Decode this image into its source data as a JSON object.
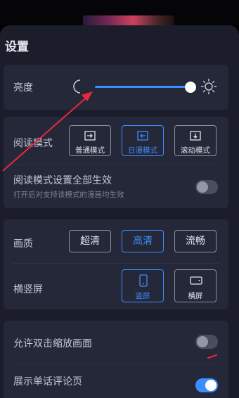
{
  "title": "设置",
  "brightness": {
    "label": "亮度",
    "level": 1.0
  },
  "reading_mode": {
    "label": "阅读模式",
    "options": [
      {
        "label": "普通模式",
        "icon": "arrow-right-icon",
        "active": false
      },
      {
        "label": "日漫模式",
        "icon": "arrow-left-icon",
        "active": true
      },
      {
        "label": "滚动模式",
        "icon": "arrow-down-icon",
        "active": false
      }
    ]
  },
  "apply_all": {
    "label": "阅读模式设置全部生效",
    "sub": "打开后对支持该模式的漫画均生效",
    "on": false
  },
  "quality": {
    "label": "画质",
    "options": [
      {
        "label": "超清",
        "active": false
      },
      {
        "label": "高清",
        "active": true
      },
      {
        "label": "流畅",
        "active": false
      }
    ]
  },
  "orientation": {
    "label": "横竖屏",
    "options": [
      {
        "label": "竖屏",
        "icon": "portrait-phone-icon",
        "active": true
      },
      {
        "label": "横屏",
        "icon": "landscape-phone-icon",
        "active": false
      }
    ]
  },
  "double_tap_zoom": {
    "label": "允许双击缩放画面",
    "on": false
  },
  "show_comments": {
    "label": "展示单话评论页",
    "on": true
  },
  "colors": {
    "accent": "#3c8dff",
    "annotation": "#e8283c",
    "panel": "#1b1d2b",
    "card": "#252838"
  }
}
